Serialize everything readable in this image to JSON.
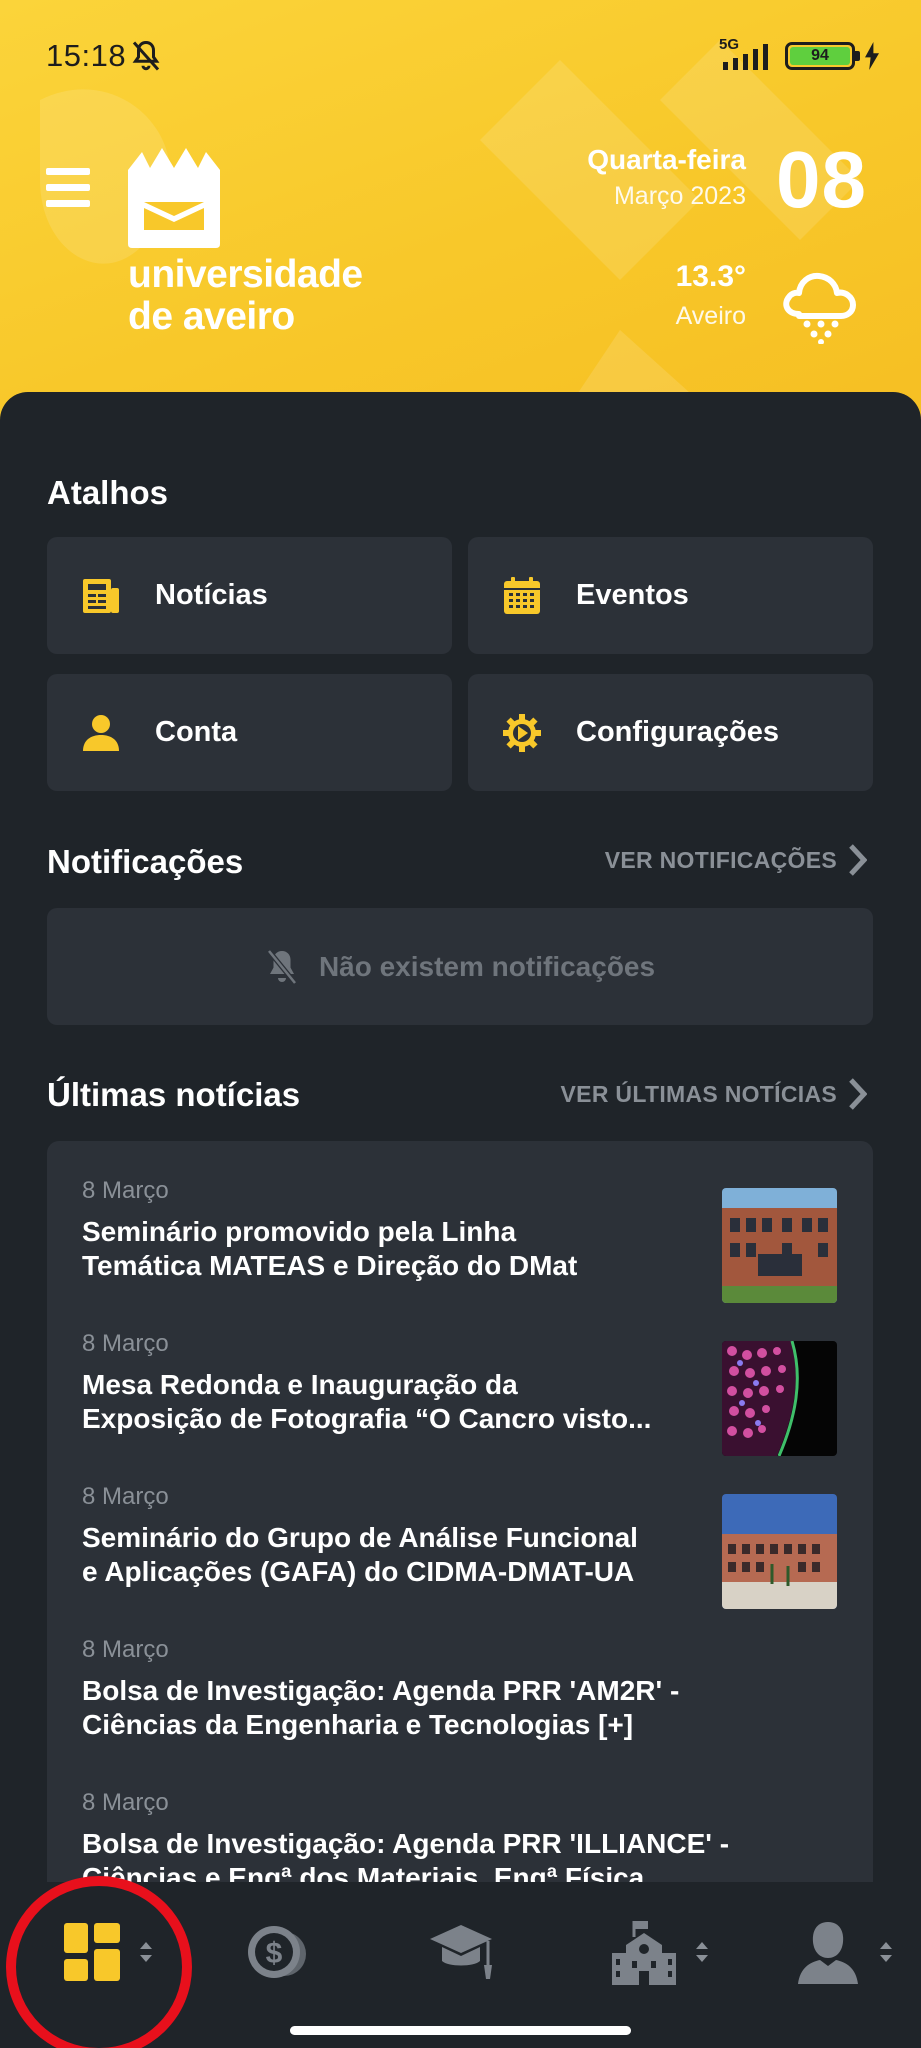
{
  "status_bar": {
    "time": "15:18",
    "network": "5G",
    "battery": "94"
  },
  "header": {
    "logo_line1": "universidade",
    "logo_line2": "de aveiro",
    "weekday": "Quarta-feira",
    "month_year": "Março 2023",
    "day": "08",
    "temperature": "13.3°",
    "city": "Aveiro",
    "weather_icon": "cloud-rain-icon"
  },
  "shortcuts": {
    "title": "Atalhos",
    "items": [
      {
        "label": "Notícias",
        "icon": "newspaper-icon"
      },
      {
        "label": "Eventos",
        "icon": "calendar-icon"
      },
      {
        "label": "Conta",
        "icon": "user-icon"
      },
      {
        "label": "Configurações",
        "icon": "gear-icon"
      }
    ]
  },
  "notifications": {
    "title": "Notificações",
    "link": "VER NOTIFICAÇÕES",
    "empty_text": "Não existem notificações"
  },
  "news": {
    "title": "Últimas notícias",
    "link": "VER ÚLTIMAS NOTÍCIAS",
    "items": [
      {
        "date": "8 Março",
        "line1": "Seminário promovido pela Linha",
        "line2": "Temática MATEAS e Direção do DMat"
      },
      {
        "date": "8 Março",
        "line1": "Mesa Redonda e Inauguração da",
        "line2": "Exposição de Fotografia “O Cancro visto..."
      },
      {
        "date": "8 Março",
        "line1": "Seminário do Grupo de Análise Funcional",
        "line2": "e Aplicações (GAFA) do CIDMA-DMAT-UA"
      },
      {
        "date": "8 Março",
        "line1": "Bolsa de Investigação: Agenda PRR 'AM2R' -",
        "line2": "Ciências da Engenharia e Tecnologias [+]"
      },
      {
        "date": "8 Março",
        "line1": "Bolsa de Investigação: Agenda PRR 'ILLIANCE' -",
        "line2": "Ciências e Engª dos Materiais, Engª Física"
      }
    ]
  },
  "bottom_nav": {
    "items": [
      "dashboard-icon",
      "money-icon",
      "graduation-cap-icon",
      "university-building-icon",
      "person-icon"
    ],
    "active": "dashboard-icon"
  },
  "colors": {
    "accent": "#f8c82a",
    "background": "#1f2429",
    "card": "#2c3138",
    "muted": "#8a9097",
    "highlight": "#e8101c"
  }
}
